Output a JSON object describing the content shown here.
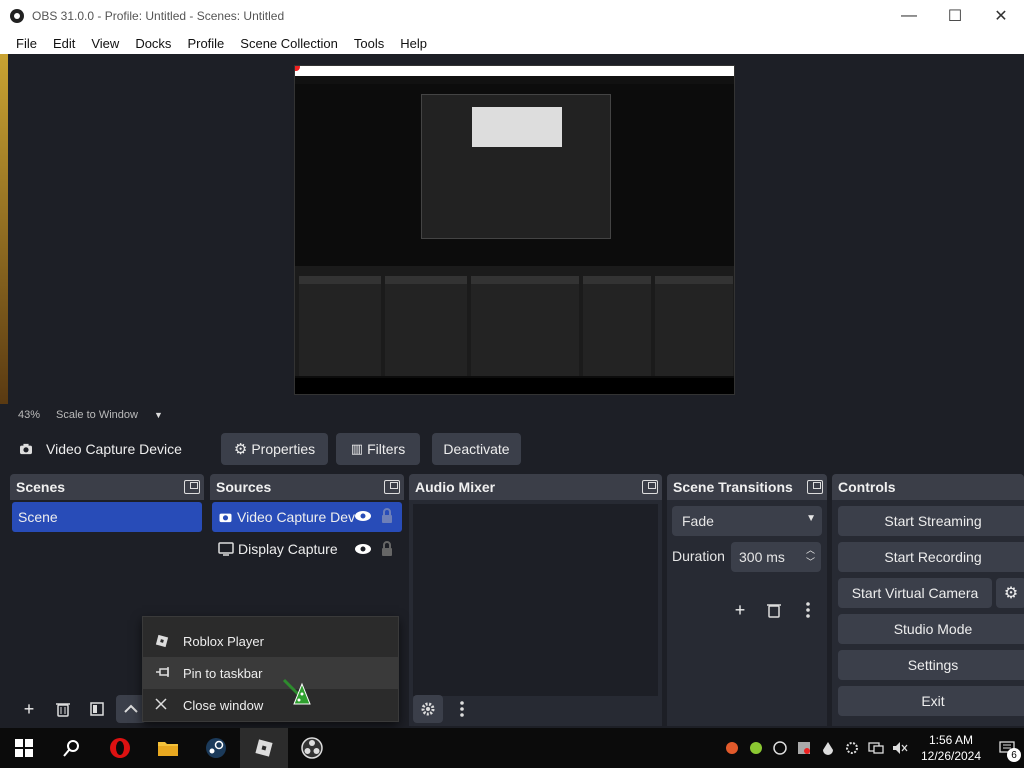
{
  "window": {
    "title": "OBS 31.0.0 - Profile: Untitled - Scenes: Untitled",
    "controls": {
      "minimize": "—",
      "maximize": "☐",
      "close": "✕"
    }
  },
  "menu": {
    "items": [
      "File",
      "Edit",
      "View",
      "Docks",
      "Profile",
      "Scene Collection",
      "Tools",
      "Help"
    ]
  },
  "preview": {
    "zoom": "43%",
    "scale_mode": "Scale to Window"
  },
  "source_toolbar": {
    "source_name": "Video Capture Device",
    "properties": "Properties",
    "filters": "Filters",
    "deactivate": "Deactivate"
  },
  "scenes": {
    "title": "Scenes",
    "items": [
      "Scene"
    ]
  },
  "sources": {
    "title": "Sources",
    "items": [
      "Video Capture Dev",
      "Display Capture"
    ]
  },
  "audio_mixer": {
    "title": "Audio Mixer"
  },
  "transitions": {
    "title": "Scene Transitions",
    "selected": "Fade",
    "duration_label": "Duration",
    "duration_value": "300 ms"
  },
  "controls": {
    "title": "Controls",
    "start_streaming": "Start Streaming",
    "start_recording": "Start Recording",
    "start_virtual_camera": "Start Virtual Camera",
    "studio_mode": "Studio Mode",
    "settings": "Settings",
    "exit": "Exit"
  },
  "context_menu": {
    "items": [
      "Roblox Player",
      "Pin to taskbar",
      "Close window"
    ]
  },
  "taskbar": {
    "time": "1:56 AM",
    "date": "12/26/2024",
    "notification_count": "6"
  }
}
